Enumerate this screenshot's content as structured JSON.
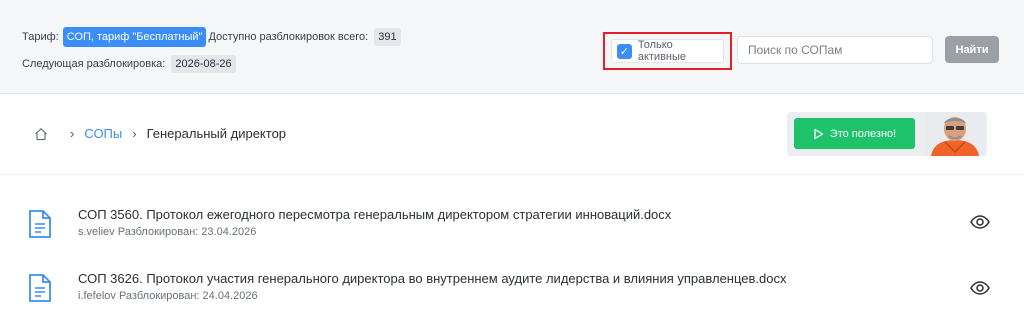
{
  "header": {
    "tariff_label": "Тариф:",
    "tariff_value": "СОП, тариф \"Бесплатный\"",
    "available_label": "Доступно разблокировок всего:",
    "available_value": "391",
    "next_label": "Следующая разблокировка:",
    "next_value": "2026-08-26"
  },
  "filter": {
    "label": "Только активные",
    "checked": true
  },
  "search": {
    "placeholder": "Поиск по СОПам",
    "value": ""
  },
  "find_button": {
    "label": "Найти"
  },
  "breadcrumb": {
    "home_icon": "home-icon",
    "items": [
      "СОПы",
      "Генеральный директор"
    ]
  },
  "promo": {
    "label": "Это полезно!",
    "icon": "play-icon"
  },
  "documents": [
    {
      "title": "СОП 3560. Протокол ежегодного пересмотра генеральным директором стратегии инноваций.docx",
      "meta": "s.veliev Разблокирован: 23.04.2026"
    },
    {
      "title": "СОП 3626. Протокол участия генерального директора во внутреннем аудите лидерства и влияния управленцев.docx",
      "meta": "i.fefelov Разблокирован: 24.04.2026"
    }
  ],
  "colors": {
    "accent": "#3a8ef6",
    "promo": "#1ec26a",
    "highlight": "#e5202a"
  }
}
